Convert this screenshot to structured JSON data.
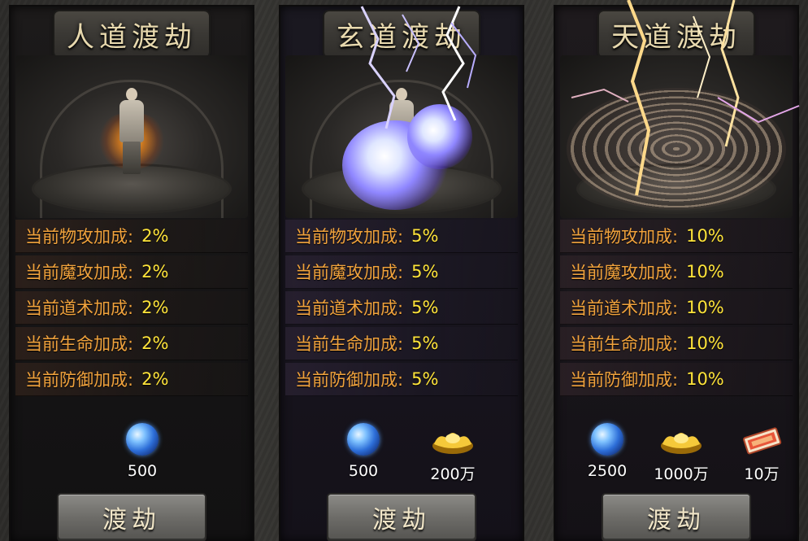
{
  "panels": [
    {
      "title": "人道渡劫",
      "stats": [
        {
          "label": "当前物攻加成:",
          "value": "2%"
        },
        {
          "label": "当前魔攻加成:",
          "value": "2%"
        },
        {
          "label": "当前道术加成:",
          "value": "2%"
        },
        {
          "label": "当前生命加成:",
          "value": "2%"
        },
        {
          "label": "当前防御加成:",
          "value": "2%"
        }
      ],
      "costs": [
        {
          "icon": "spirit-orb-icon",
          "amount": "500"
        }
      ],
      "button_label": "渡劫"
    },
    {
      "title": "玄道渡劫",
      "stats": [
        {
          "label": "当前物攻加成:",
          "value": "5%"
        },
        {
          "label": "当前魔攻加成:",
          "value": "5%"
        },
        {
          "label": "当前道术加成:",
          "value": "5%"
        },
        {
          "label": "当前生命加成:",
          "value": "5%"
        },
        {
          "label": "当前防御加成:",
          "value": "5%"
        }
      ],
      "costs": [
        {
          "icon": "spirit-orb-icon",
          "amount": "500"
        },
        {
          "icon": "gold-ingot-icon",
          "amount": "200万"
        }
      ],
      "button_label": "渡劫"
    },
    {
      "title": "天道渡劫",
      "stats": [
        {
          "label": "当前物攻加成:",
          "value": "10%"
        },
        {
          "label": "当前魔攻加成:",
          "value": "10%"
        },
        {
          "label": "当前道术加成:",
          "value": "10%"
        },
        {
          "label": "当前生命加成:",
          "value": "10%"
        },
        {
          "label": "当前防御加成:",
          "value": "10%"
        }
      ],
      "costs": [
        {
          "icon": "spirit-orb-icon",
          "amount": "2500"
        },
        {
          "icon": "gold-ingot-icon",
          "amount": "1000万"
        },
        {
          "icon": "bank-note-icon",
          "amount": "10万"
        }
      ],
      "button_label": "渡劫"
    }
  ],
  "colors": {
    "stat_label": "#f0a23c",
    "stat_value": "#ffe43a",
    "title_text": "#e8d9ae"
  }
}
